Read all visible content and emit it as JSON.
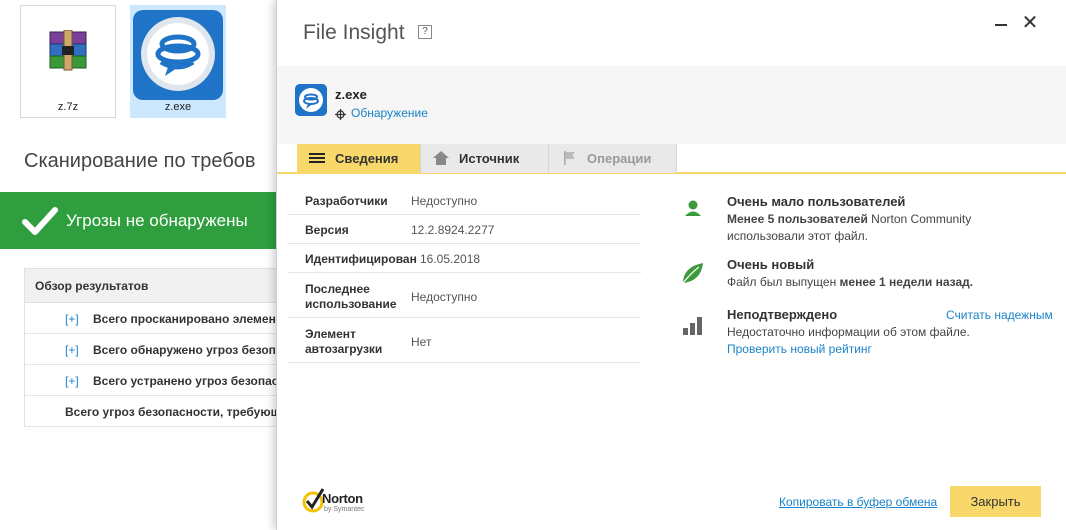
{
  "desktop": {
    "files": [
      {
        "name": "z.7z",
        "icon": "archive-icon"
      },
      {
        "name": "z.exe",
        "icon": "app-icon"
      }
    ]
  },
  "scan_window": {
    "title": "Сканирование по требов",
    "banner_text": "Угрозы не обнаружены",
    "results_header": "Обзор результатов",
    "rows": [
      {
        "plus": "[+]",
        "text": "Всего просканировано элемент"
      },
      {
        "plus": "[+]",
        "text": "Всего обнаружено угроз безоп"
      },
      {
        "plus": "[+]",
        "text": "Всего устранено угроз безопас"
      },
      {
        "plus": "",
        "text": "Всего угроз безопасности, требующ"
      }
    ],
    "colors": {
      "banner": "#2e9e3e"
    }
  },
  "dialog": {
    "title": "File Insight",
    "help": "?",
    "file_name": "z.exe",
    "detect_link": "Обнаружение",
    "tabs": [
      {
        "label": "Сведения",
        "icon": "list-icon",
        "state": "active"
      },
      {
        "label": "Источник",
        "icon": "home-icon",
        "state": "normal"
      },
      {
        "label": "Операции",
        "icon": "flag-icon",
        "state": "disabled"
      }
    ],
    "details": [
      {
        "key": "Разработчики",
        "value": "Недоступно"
      },
      {
        "key": "Версия",
        "value": "12.2.8924.2277"
      },
      {
        "key": "Идентифицирован",
        "value": "16.05.2018"
      },
      {
        "key_line1": "Последнее",
        "key_line2": "использование",
        "value": "Недоступно"
      },
      {
        "key_line1": "Элемент",
        "key_line2": "автозагрузки",
        "value": "Нет"
      }
    ],
    "insights": [
      {
        "icon": "user-icon",
        "title": "Очень мало пользователей",
        "line1_bold": "Менее 5 пользователей",
        "line1_rest": " Norton Community",
        "line2": "использовали этот файл."
      },
      {
        "icon": "leaf-icon",
        "title": "Очень новый",
        "line1_pre": "Файл был выпущен ",
        "line1_bold": "менее 1 недели назад."
      },
      {
        "icon": "bars-icon",
        "title": "Неподтверждено",
        "right_link": "Считать надежным",
        "line1": "Недостаточно информации об этом файле.",
        "link": "Проверить новый рейтинг"
      }
    ],
    "footer": {
      "logo_word": "Norton",
      "logo_sub": "by Symantec",
      "copy_link": "Копировать в буфер обмена",
      "close_button": "Закрыть"
    },
    "colors": {
      "accent": "#f8d86a",
      "link": "#1b83c9",
      "icon_green": "#3c9a3c"
    }
  }
}
